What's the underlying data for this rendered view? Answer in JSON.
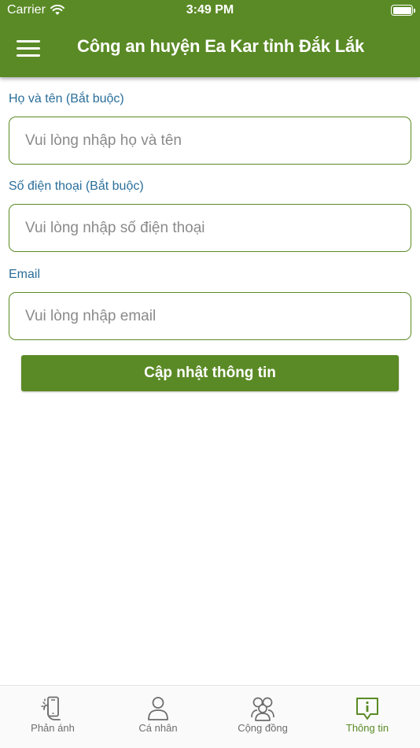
{
  "status_bar": {
    "carrier": "Carrier",
    "time": "3:49 PM"
  },
  "header": {
    "title": "Công an huyện Ea Kar tỉnh Đắk Lắk",
    "menu_icon": "hamburger-menu-icon"
  },
  "form": {
    "name": {
      "label": "Họ và tên (Bắt buộc)",
      "placeholder": "Vui lòng nhập họ và tên",
      "value": ""
    },
    "phone": {
      "label": "Số điện thoại (Bắt buộc)",
      "placeholder": "Vui lòng nhập số điện thoại",
      "value": ""
    },
    "email": {
      "label": "Email",
      "placeholder": "Vui lòng nhập email",
      "value": ""
    },
    "submit_label": "Cập nhật thông tin"
  },
  "tabbar": {
    "items": [
      {
        "label": "Phản ánh",
        "icon": "phone-report-icon",
        "active": false
      },
      {
        "label": "Cá nhân",
        "icon": "person-icon",
        "active": false
      },
      {
        "label": "Cộng đồng",
        "icon": "community-icon",
        "active": false
      },
      {
        "label": "Thông tin",
        "icon": "info-bubble-icon",
        "active": true
      }
    ]
  },
  "colors": {
    "primary": "#5a8a25",
    "label": "#2a6e9a",
    "tab_inactive": "#6d6d6d",
    "background": "#ffffff"
  }
}
